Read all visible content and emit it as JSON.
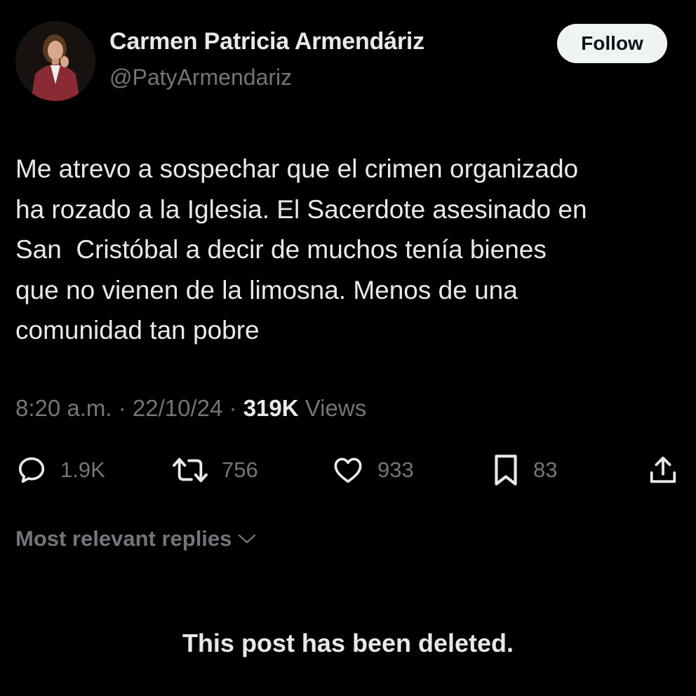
{
  "author": {
    "display_name": "Carmen Patricia Armendáriz",
    "handle": "@PatyArmendariz"
  },
  "follow_label": "Follow",
  "tweet": {
    "lines": [
      "Me atrevo a sospechar que el crimen organizado",
      "ha rozado a la Iglesia. El Sacerdote asesinado en",
      "San  Cristóbal a decir de muchos tenía bienes",
      "que no vienen de la limosna. Menos de una",
      "comunidad tan pobre"
    ]
  },
  "meta": {
    "time": "8:20 a.m.",
    "separator": " · ",
    "date": "22/10/24",
    "views_count": "319K",
    "views_label": " Views"
  },
  "actions": {
    "replies": {
      "icon": "reply-icon",
      "count": "1.9K"
    },
    "reposts": {
      "icon": "repost-icon",
      "count": "756"
    },
    "likes": {
      "icon": "heart-icon",
      "count": "933"
    },
    "bookmarks": {
      "icon": "bookmark-icon",
      "count": "83"
    },
    "share": {
      "icon": "share-icon"
    }
  },
  "replies_sort": {
    "label": "Most relevant replies",
    "icon": "chevron-down-icon"
  },
  "deleted_notice": "This post has been deleted.",
  "colors": {
    "background": "#000000",
    "primary_text": "#e7e9ea",
    "secondary_text": "#71767b",
    "follow_button_bg": "#eff3f4",
    "follow_button_text": "#0f1419"
  }
}
